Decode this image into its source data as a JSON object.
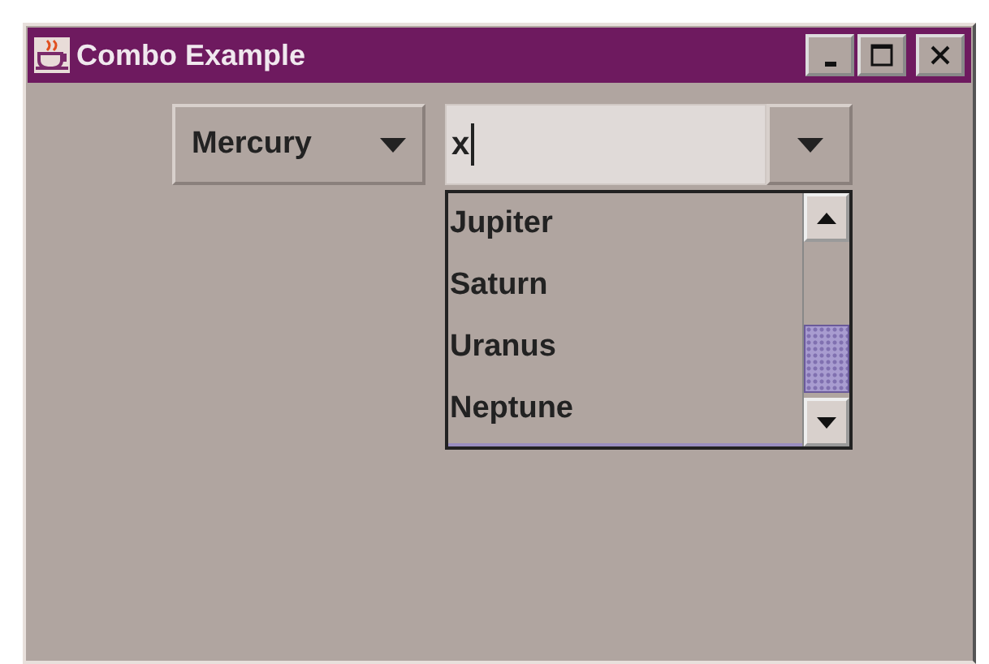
{
  "window": {
    "title": "Combo Example"
  },
  "planet_combo": {
    "value": "Mercury"
  },
  "editable_combo": {
    "value": "x"
  },
  "popup": {
    "items": [
      {
        "label": "Jupiter",
        "selected": false
      },
      {
        "label": "Saturn",
        "selected": false
      },
      {
        "label": "Uranus",
        "selected": false
      },
      {
        "label": "Neptune",
        "selected": false
      }
    ]
  }
}
